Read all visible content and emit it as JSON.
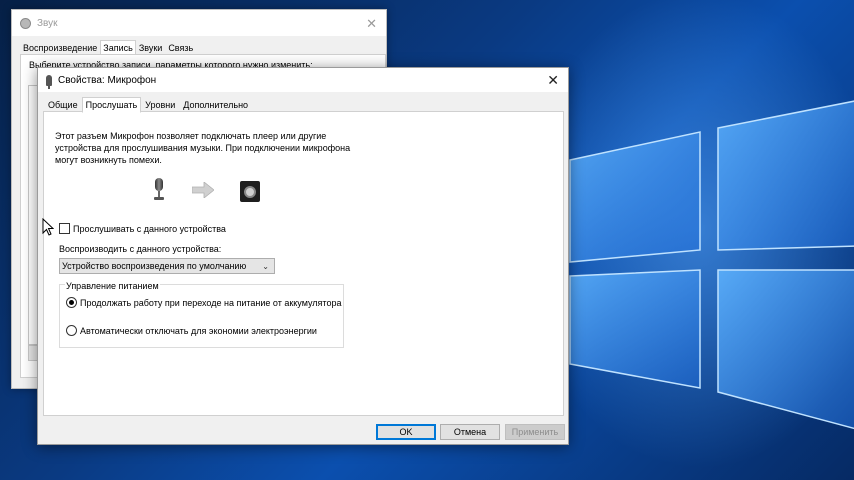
{
  "back_window": {
    "title": "Звук",
    "tabs": [
      "Воспроизведение",
      "Запись",
      "Звуки",
      "Связь"
    ],
    "active_tab_index": 1,
    "hint": "Выберите устройство записи, параметры которого нужно изменить:"
  },
  "dialog": {
    "title": "Свойства: Микрофон",
    "tabs": [
      "Общие",
      "Прослушать",
      "Уровни",
      "Дополнительно"
    ],
    "active_tab_index": 1,
    "description_lines": [
      "Этот разъем Микрофон позволяет подключать плеер или другие",
      "устройства для прослушивания музыки. При подключении микрофона",
      "могут возникнуть помехи."
    ],
    "listen_checkbox": {
      "label": "Прослушивать с данного устройства",
      "checked": false
    },
    "playback_label": "Воспроизводить с данного устройства:",
    "playback_select": {
      "value": "Устройство воспроизведения по умолчанию"
    },
    "power": {
      "legend": "Управление питанием",
      "options": [
        {
          "label": "Продолжать работу при переходе на питание от аккумулятора",
          "selected": true
        },
        {
          "label": "Автоматически отключать для экономии электроэнергии",
          "selected": false
        }
      ]
    },
    "buttons": {
      "ok": "OK",
      "cancel": "Отмена",
      "apply": "Применить"
    }
  },
  "icons": {
    "back_title_icon": "speaker-icon",
    "dialog_title_icon": "microphone-icon",
    "source_icon": "microphone-icon",
    "flow_icon": "arrow-right-icon",
    "target_icon": "speaker-icon"
  },
  "colors": {
    "accent": "#0078d7",
    "desktop_blue": "#0b4fae"
  }
}
